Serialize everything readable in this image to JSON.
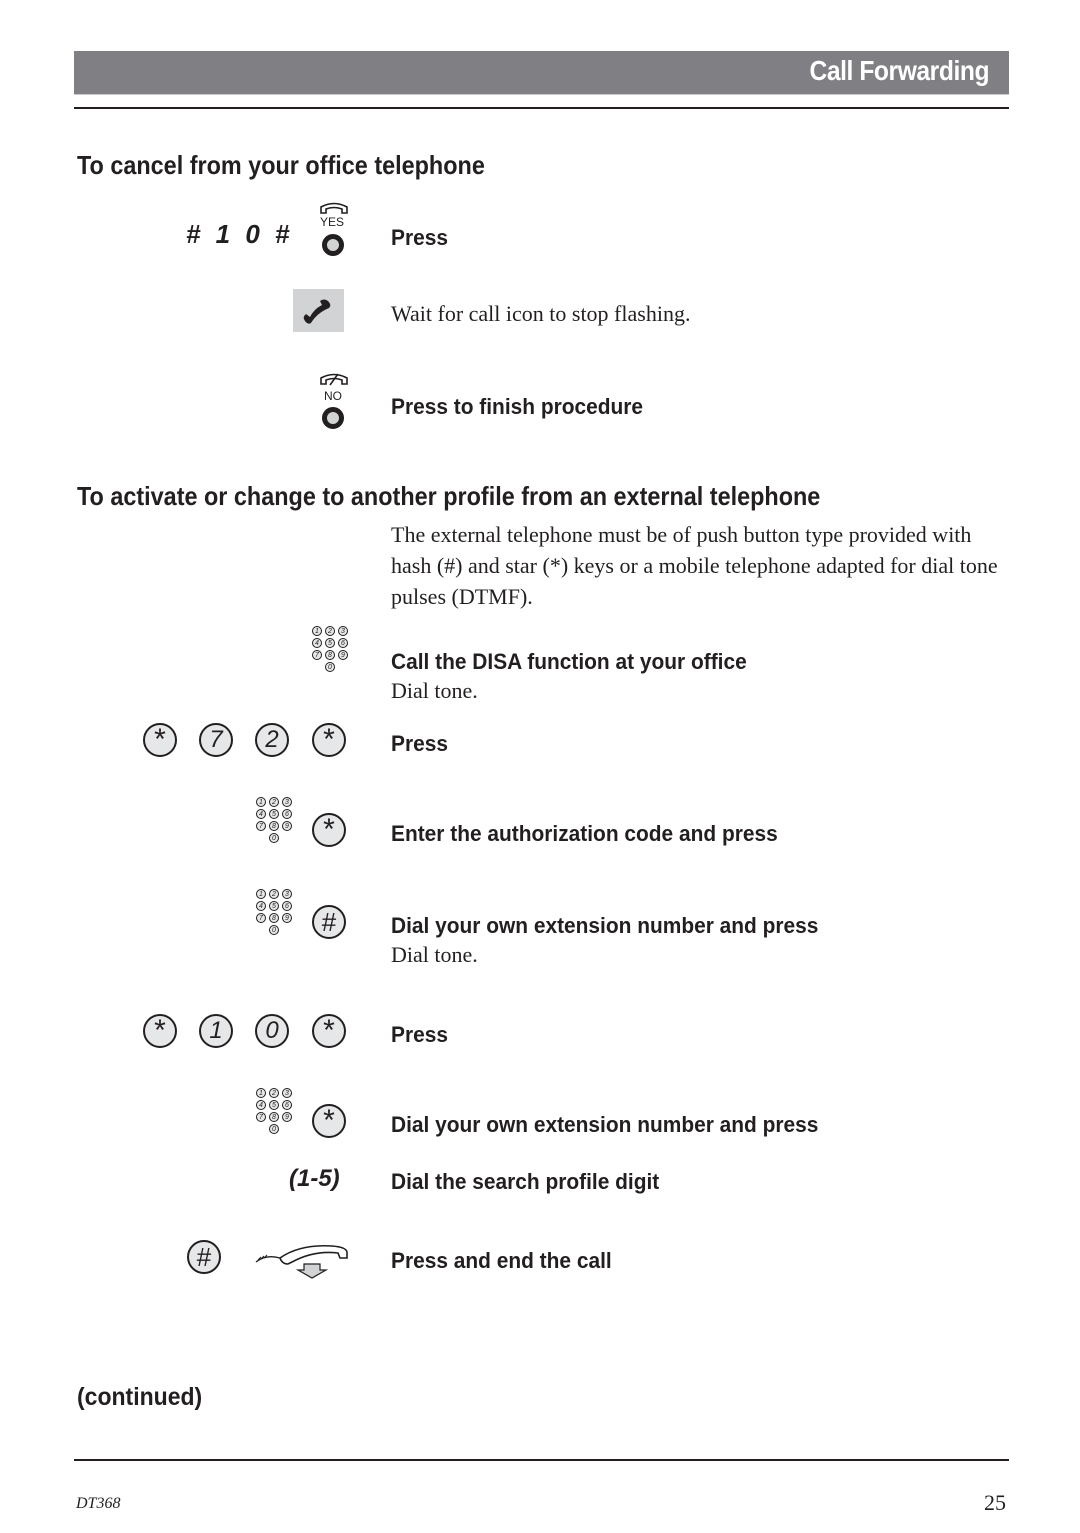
{
  "header": {
    "title": "Call Forwarding"
  },
  "section_cancel": {
    "heading": "To cancel from your office telephone",
    "steps": [
      {
        "keys": "# 1 0 #",
        "key_icon": "yes-button-icon",
        "key_label": "YES",
        "instruction": "Press"
      },
      {
        "key_icon": "call-display-icon",
        "description": "Wait for call icon to stop flashing."
      },
      {
        "key_icon": "no-button-icon",
        "key_label": "NO",
        "instruction": "Press to finish procedure"
      }
    ]
  },
  "section_activate": {
    "heading": "To activate or change to another profile from an external telephone",
    "intro": "The external telephone must be of push button type provided with hash (#) and star (*) keys or a mobile telephone adapted for dial tone pulses (DTMF).",
    "steps": [
      {
        "key_icon": "keypad-icon",
        "instruction": "Call the DISA function at your office",
        "note": "Dial tone."
      },
      {
        "keys": [
          "*",
          "7",
          "2",
          "*"
        ],
        "instruction": "Press"
      },
      {
        "key_icon": "keypad-icon",
        "keys": [
          "*"
        ],
        "instruction": "Enter the authorization code and press"
      },
      {
        "key_icon": "keypad-icon",
        "keys": [
          "#"
        ],
        "instruction": "Dial your own extension number and press",
        "note": "Dial tone."
      },
      {
        "keys": [
          "*",
          "1",
          "0",
          "*"
        ],
        "instruction": "Press"
      },
      {
        "key_icon": "keypad-icon",
        "keys": [
          "*"
        ],
        "instruction": "Dial your own extension number and press"
      },
      {
        "range": "(1-5)",
        "instruction": "Dial the search profile digit"
      },
      {
        "keys": [
          "#"
        ],
        "key_icon": "handset-down-icon",
        "instruction": "Press and end the call"
      }
    ]
  },
  "keypad_digits": [
    "1",
    "2",
    "3",
    "4",
    "5",
    "6",
    "7",
    "8",
    "9",
    "0"
  ],
  "continued_label": "(continued)",
  "footer": {
    "doc_id": "DT368",
    "page_number": "25"
  }
}
